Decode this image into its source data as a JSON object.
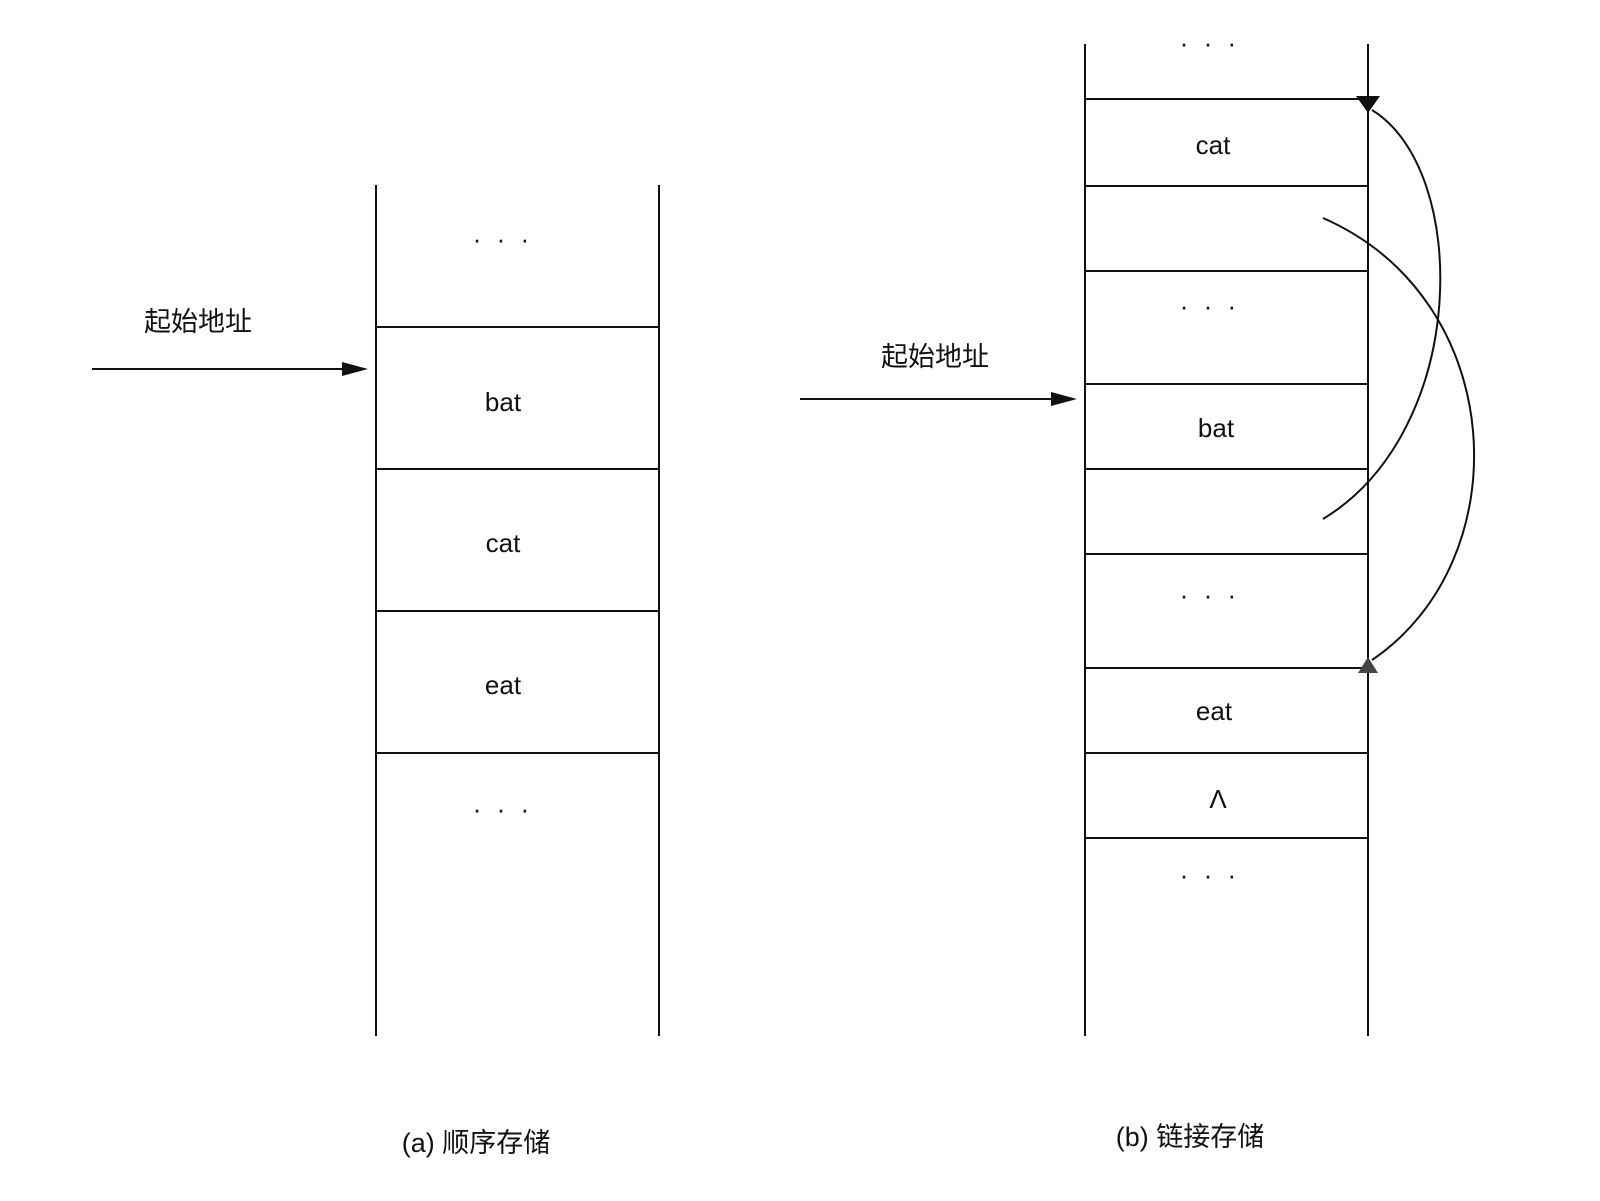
{
  "diagram": {
    "sequential": {
      "caption": "(a) 顺序存储",
      "start_label": "起始地址",
      "cells": [
        "· · ·",
        "bat",
        "cat",
        "eat",
        "· · ·"
      ]
    },
    "linked": {
      "caption": "(b) 链接存储",
      "start_label": "起始地址",
      "cells": [
        "· · ·",
        "cat",
        "",
        "· · ·",
        "bat",
        "",
        "· · ·",
        "eat",
        "Λ",
        "· · ·"
      ],
      "links": [
        {
          "from": "bat-pointer",
          "to": "cat"
        },
        {
          "from": "cat-pointer",
          "to": "eat"
        }
      ]
    },
    "colors": {
      "stroke": "#111111",
      "arrow_up": "#444444"
    }
  }
}
